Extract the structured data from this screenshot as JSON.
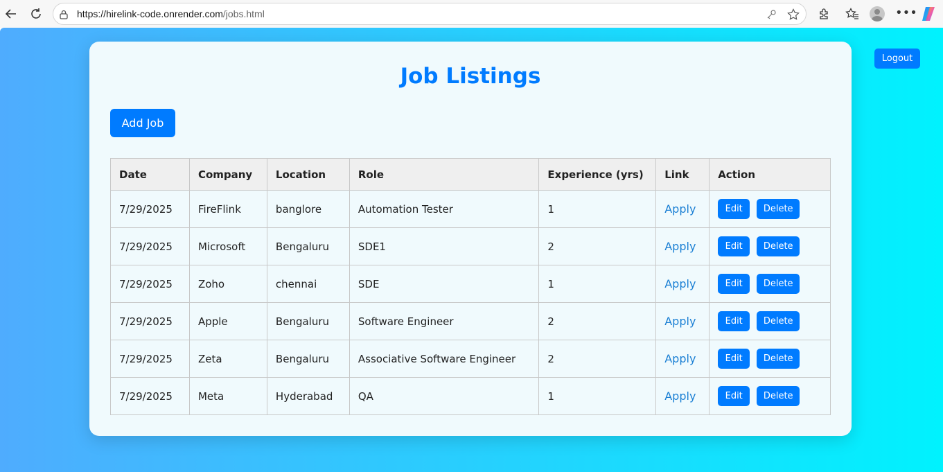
{
  "browser": {
    "url_host": "https://hirelink-code.onrender.com",
    "url_path": "/jobs.html"
  },
  "page": {
    "title": "Job Listings",
    "add_job_label": "Add Job",
    "logout_label": "Logout"
  },
  "table": {
    "headers": [
      "Date",
      "Company",
      "Location",
      "Role",
      "Experience (yrs)",
      "Link",
      "Action"
    ],
    "rows": [
      {
        "date": "7/29/2025",
        "company": "FireFlink",
        "location": "banglore",
        "role": "Automation Tester",
        "experience": "1",
        "link": "Apply",
        "edit": "Edit",
        "delete": "Delete"
      },
      {
        "date": "7/29/2025",
        "company": "Microsoft",
        "location": "Bengaluru",
        "role": "SDE1",
        "experience": "2",
        "link": "Apply",
        "edit": "Edit",
        "delete": "Delete"
      },
      {
        "date": "7/29/2025",
        "company": "Zoho",
        "location": "chennai",
        "role": "SDE",
        "experience": "1",
        "link": "Apply",
        "edit": "Edit",
        "delete": "Delete"
      },
      {
        "date": "7/29/2025",
        "company": "Apple",
        "location": "Bengaluru",
        "role": "Software Engineer",
        "experience": "2",
        "link": "Apply",
        "edit": "Edit",
        "delete": "Delete"
      },
      {
        "date": "7/29/2025",
        "company": "Zeta",
        "location": "Bengaluru",
        "role": "Associative Software Engineer",
        "experience": "2",
        "link": "Apply",
        "edit": "Edit",
        "delete": "Delete"
      },
      {
        "date": "7/29/2025",
        "company": "Meta",
        "location": "Hyderabad",
        "role": "QA",
        "experience": "1",
        "link": "Apply",
        "edit": "Edit",
        "delete": "Delete"
      }
    ]
  },
  "icons": {
    "back": "back-arrow-icon",
    "refresh": "refresh-icon",
    "lock": "lock-icon",
    "key": "key-icon",
    "favorite": "star-icon",
    "extensions": "extensions-icon",
    "favorites": "favorites-icon",
    "profile": "profile-icon",
    "more": "more-icon",
    "copilot": "copilot-icon"
  },
  "colors": {
    "accent": "#007bff",
    "gradient_start": "#4facfe",
    "gradient_end": "#00f2fe",
    "card_bg": "#f0fafd"
  }
}
